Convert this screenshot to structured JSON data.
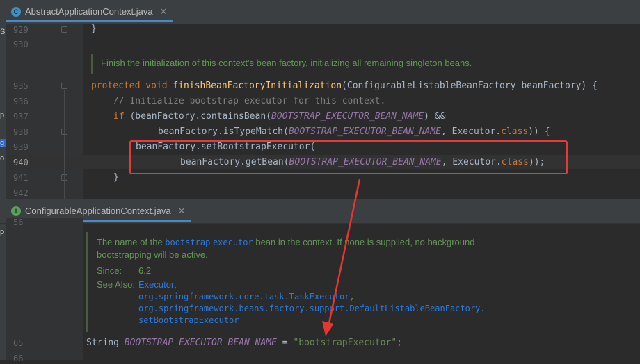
{
  "top_editor": {
    "tab": {
      "icon_letter": "C",
      "title": "AbstractApplicationContext.java",
      "close": "✕"
    },
    "lines": [
      {
        "no": "929"
      },
      {
        "no": "930"
      },
      {
        "no": "935"
      },
      {
        "no": "936"
      },
      {
        "no": "937"
      },
      {
        "no": "938"
      },
      {
        "no": "939"
      },
      {
        "no": "940"
      },
      {
        "no": "941"
      },
      {
        "no": "942"
      }
    ],
    "code": {
      "brace929": "}",
      "doc": "Finish the initialization of this context's bean factory, initializing all remaining singleton beans.",
      "l935_kw": "protected void ",
      "l935_fn": "finishBeanFactoryInitialization",
      "l935_rest": "(ConfigurableListableBeanFactory beanFactory) {",
      "l936": "// Initialize bootstrap executor for this context.",
      "l937_kw": "if ",
      "l937_a": "(beanFactory.containsBean(",
      "l937_const": "BOOTSTRAP_EXECUTOR_BEAN_NAME",
      "l937_b": ") &&",
      "l938_a": "beanFactory.isTypeMatch(",
      "l938_const": "BOOTSTRAP_EXECUTOR_BEAN_NAME",
      "l938_b": ", Executor.",
      "l938_kw": "class",
      "l938_c": ")) {",
      "l939": "beanFactory.setBootstrapExecutor(",
      "l940_a": "beanFactory.getBean(",
      "l940_const": "BOOTSTRAP_EXECUTOR_BEAN_NAME",
      "l940_b": ", Executor.",
      "l940_kw": "class",
      "l940_c": "));",
      "l941": "}"
    }
  },
  "bottom_editor": {
    "tab": {
      "icon_letter": "I",
      "title": "ConfigurableApplicationContext.java",
      "close": "✕"
    },
    "lines": [
      {
        "no": "56"
      },
      {
        "no": "65"
      },
      {
        "no": "66"
      }
    ],
    "doc": {
      "p1_a": "The name of the ",
      "p1_code1": "bootstrap",
      "p1_code2": "executor",
      "p1_b": " bean in the context. If none is supplied, no background",
      "p1_c": "bootstrapping will be active.",
      "since_label": "Since:",
      "since_value": "6.2",
      "see_label": "See Also:",
      "see_1": "Executor",
      "see_1_sep": ",",
      "see_2": "org.springframework.core.task.TaskExecutor",
      "see_2_sep": ",",
      "see_3": "org.springframework.beans.factory.support.DefaultListableBeanFactory.",
      "see_4": "setBootstrapExecutor"
    },
    "code": {
      "type": "String ",
      "const": "BOOTSTRAP_EXECUTOR_BEAN_NAME",
      "eq": " = ",
      "str": "\"bootstrapExecutor\"",
      "semi": ";"
    }
  },
  "left_edge_fragments": [
    "Sp",
    "p",
    "g",
    "o",
    "p"
  ],
  "colors": {
    "highlight_box": "#e23b3b",
    "arrow": "#e8352f",
    "class_icon": "#3d8fc4",
    "interface_icon": "#56a05a"
  }
}
